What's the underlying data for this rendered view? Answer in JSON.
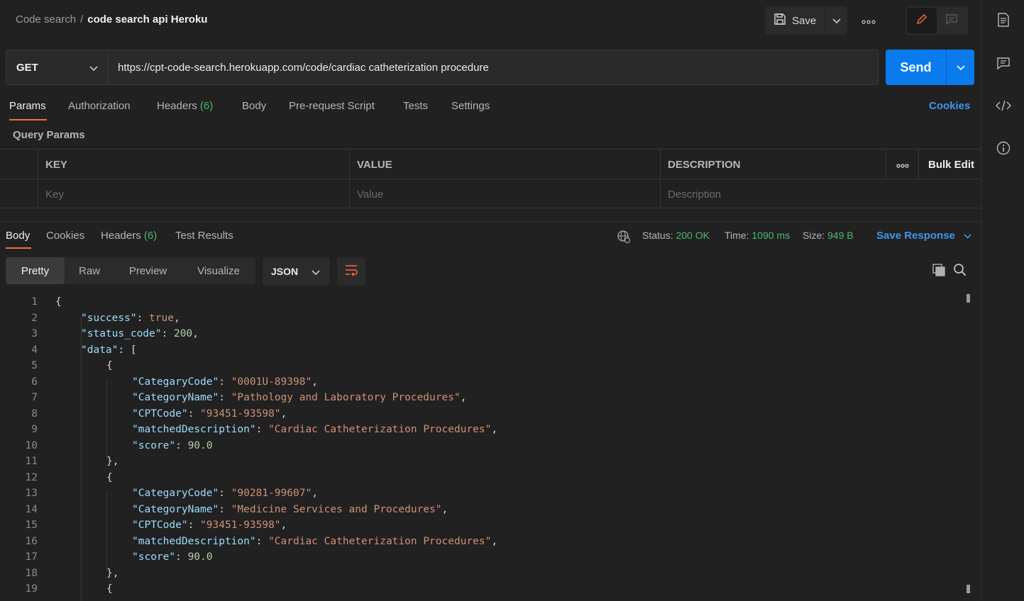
{
  "breadcrumb": {
    "parent": "Code search",
    "separator": "/",
    "current": "code search api Heroku"
  },
  "toolbar": {
    "save_label": "Save",
    "more_icon": "more-horizontal-icon"
  },
  "request": {
    "method": "GET",
    "url": "https://cpt-code-search.herokuapp.com/code/cardiac catheterization procedure",
    "send_label": "Send"
  },
  "request_tabs": [
    {
      "label": "Params",
      "count": ""
    },
    {
      "label": "Authorization",
      "count": ""
    },
    {
      "label": "Headers",
      "count": "(6)"
    },
    {
      "label": "Body",
      "count": ""
    },
    {
      "label": "Pre-request Script",
      "count": ""
    },
    {
      "label": "Tests",
      "count": ""
    },
    {
      "label": "Settings",
      "count": ""
    }
  ],
  "cookies_label": "Cookies",
  "query_params": {
    "title": "Query Params",
    "headers": {
      "key": "KEY",
      "value": "VALUE",
      "description": "DESCRIPTION",
      "bulk_edit": "Bulk Edit"
    },
    "placeholders": {
      "key": "Key",
      "value": "Value",
      "description": "Description"
    }
  },
  "response": {
    "tabs": [
      {
        "label": "Body",
        "count": ""
      },
      {
        "label": "Cookies",
        "count": ""
      },
      {
        "label": "Headers",
        "count": "(6)"
      },
      {
        "label": "Test Results",
        "count": ""
      }
    ],
    "status_label": "Status:",
    "status_value": "200 OK",
    "time_label": "Time:",
    "time_value": "1090 ms",
    "size_label": "Size:",
    "size_value": "949 B",
    "save_response": "Save Response",
    "views": [
      "Pretty",
      "Raw",
      "Preview",
      "Visualize"
    ],
    "format": "JSON"
  },
  "code_lines": [
    {
      "n": "1",
      "indent": 0,
      "tokens": [
        [
          "p",
          "{"
        ]
      ]
    },
    {
      "n": "2",
      "indent": 1,
      "tokens": [
        [
          "k",
          "\"success\""
        ],
        [
          "p",
          ": "
        ],
        [
          "b",
          "true"
        ],
        [
          "p",
          ","
        ]
      ]
    },
    {
      "n": "3",
      "indent": 1,
      "tokens": [
        [
          "k",
          "\"status_code\""
        ],
        [
          "p",
          ": "
        ],
        [
          "n",
          "200"
        ],
        [
          "p",
          ","
        ]
      ]
    },
    {
      "n": "4",
      "indent": 1,
      "tokens": [
        [
          "k",
          "\"data\""
        ],
        [
          "p",
          ": ["
        ]
      ]
    },
    {
      "n": "5",
      "indent": 2,
      "tokens": [
        [
          "p",
          "{"
        ]
      ]
    },
    {
      "n": "6",
      "indent": 3,
      "tokens": [
        [
          "k",
          "\"CategaryCode\""
        ],
        [
          "p",
          ": "
        ],
        [
          "s",
          "\"0001U-89398\""
        ],
        [
          "p",
          ","
        ]
      ]
    },
    {
      "n": "7",
      "indent": 3,
      "tokens": [
        [
          "k",
          "\"CategoryName\""
        ],
        [
          "p",
          ": "
        ],
        [
          "s",
          "\"Pathology and Laboratory Procedures\""
        ],
        [
          "p",
          ","
        ]
      ]
    },
    {
      "n": "8",
      "indent": 3,
      "tokens": [
        [
          "k",
          "\"CPTCode\""
        ],
        [
          "p",
          ": "
        ],
        [
          "s",
          "\"93451-93598\""
        ],
        [
          "p",
          ","
        ]
      ]
    },
    {
      "n": "9",
      "indent": 3,
      "tokens": [
        [
          "k",
          "\"matchedDescription\""
        ],
        [
          "p",
          ": "
        ],
        [
          "s",
          "\"Cardiac Catheterization Procedures\""
        ],
        [
          "p",
          ","
        ]
      ]
    },
    {
      "n": "10",
      "indent": 3,
      "tokens": [
        [
          "k",
          "\"score\""
        ],
        [
          "p",
          ": "
        ],
        [
          "n",
          "90.0"
        ]
      ]
    },
    {
      "n": "11",
      "indent": 2,
      "tokens": [
        [
          "p",
          "},"
        ]
      ]
    },
    {
      "n": "12",
      "indent": 2,
      "tokens": [
        [
          "p",
          "{"
        ]
      ]
    },
    {
      "n": "13",
      "indent": 3,
      "tokens": [
        [
          "k",
          "\"CategaryCode\""
        ],
        [
          "p",
          ": "
        ],
        [
          "s",
          "\"90281-99607\""
        ],
        [
          "p",
          ","
        ]
      ]
    },
    {
      "n": "14",
      "indent": 3,
      "tokens": [
        [
          "k",
          "\"CategoryName\""
        ],
        [
          "p",
          ": "
        ],
        [
          "s",
          "\"Medicine Services and Procedures\""
        ],
        [
          "p",
          ","
        ]
      ]
    },
    {
      "n": "15",
      "indent": 3,
      "tokens": [
        [
          "k",
          "\"CPTCode\""
        ],
        [
          "p",
          ": "
        ],
        [
          "s",
          "\"93451-93598\""
        ],
        [
          "p",
          ","
        ]
      ]
    },
    {
      "n": "16",
      "indent": 3,
      "tokens": [
        [
          "k",
          "\"matchedDescription\""
        ],
        [
          "p",
          ": "
        ],
        [
          "s",
          "\"Cardiac Catheterization Procedures\""
        ],
        [
          "p",
          ","
        ]
      ]
    },
    {
      "n": "17",
      "indent": 3,
      "tokens": [
        [
          "k",
          "\"score\""
        ],
        [
          "p",
          ": "
        ],
        [
          "n",
          "90.0"
        ]
      ]
    },
    {
      "n": "18",
      "indent": 2,
      "tokens": [
        [
          "p",
          "},"
        ]
      ]
    },
    {
      "n": "19",
      "indent": 2,
      "tokens": [
        [
          "p",
          "{"
        ]
      ]
    }
  ],
  "colors": {
    "accent": "#ff6c37",
    "send": "#097bed",
    "link": "#3f96ee",
    "success": "#49b96c"
  },
  "sidebar_icons": [
    "documentation-icon",
    "comments-icon",
    "code-icon",
    "info-icon"
  ]
}
